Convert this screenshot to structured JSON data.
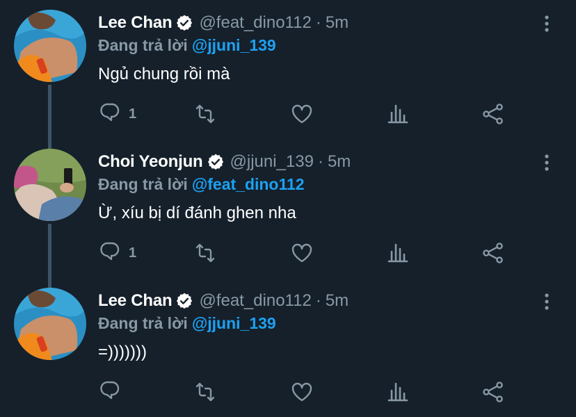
{
  "colors": {
    "background": "#15202b",
    "primary_text": "#ffffff",
    "secondary_text": "#8899a6",
    "accent": "#1da1f2",
    "thread_line": "#3d5466"
  },
  "tweets": [
    {
      "name": "Lee Chan",
      "handle": "@feat_dino112",
      "separator": "·",
      "time": "5m",
      "reply_prefix": "Đang trả lời",
      "reply_to": "@jjuni_139",
      "text": "Ngủ chung rồi mà",
      "reply_count": "1",
      "verified": true,
      "icons": [
        "reply-icon",
        "retweet-icon",
        "like-icon",
        "views-icon",
        "share-icon",
        "more-icon"
      ]
    },
    {
      "name": "Choi Yeonjun",
      "handle": "@jjuni_139",
      "separator": "·",
      "time": "5m",
      "reply_prefix": "Đang trả lời",
      "reply_to": "@feat_dino112",
      "text": "Ừ, xíu bị dí đánh ghen nha",
      "reply_count": "1",
      "verified": true,
      "icons": [
        "reply-icon",
        "retweet-icon",
        "like-icon",
        "views-icon",
        "share-icon",
        "more-icon"
      ]
    },
    {
      "name": "Lee Chan",
      "handle": "@feat_dino112",
      "separator": "·",
      "time": "5m",
      "reply_prefix": "Đang trả lời",
      "reply_to": "@jjuni_139",
      "text": "=)))))))",
      "reply_count": "",
      "verified": true,
      "icons": [
        "reply-icon",
        "retweet-icon",
        "like-icon",
        "views-icon",
        "share-icon",
        "more-icon"
      ]
    }
  ]
}
